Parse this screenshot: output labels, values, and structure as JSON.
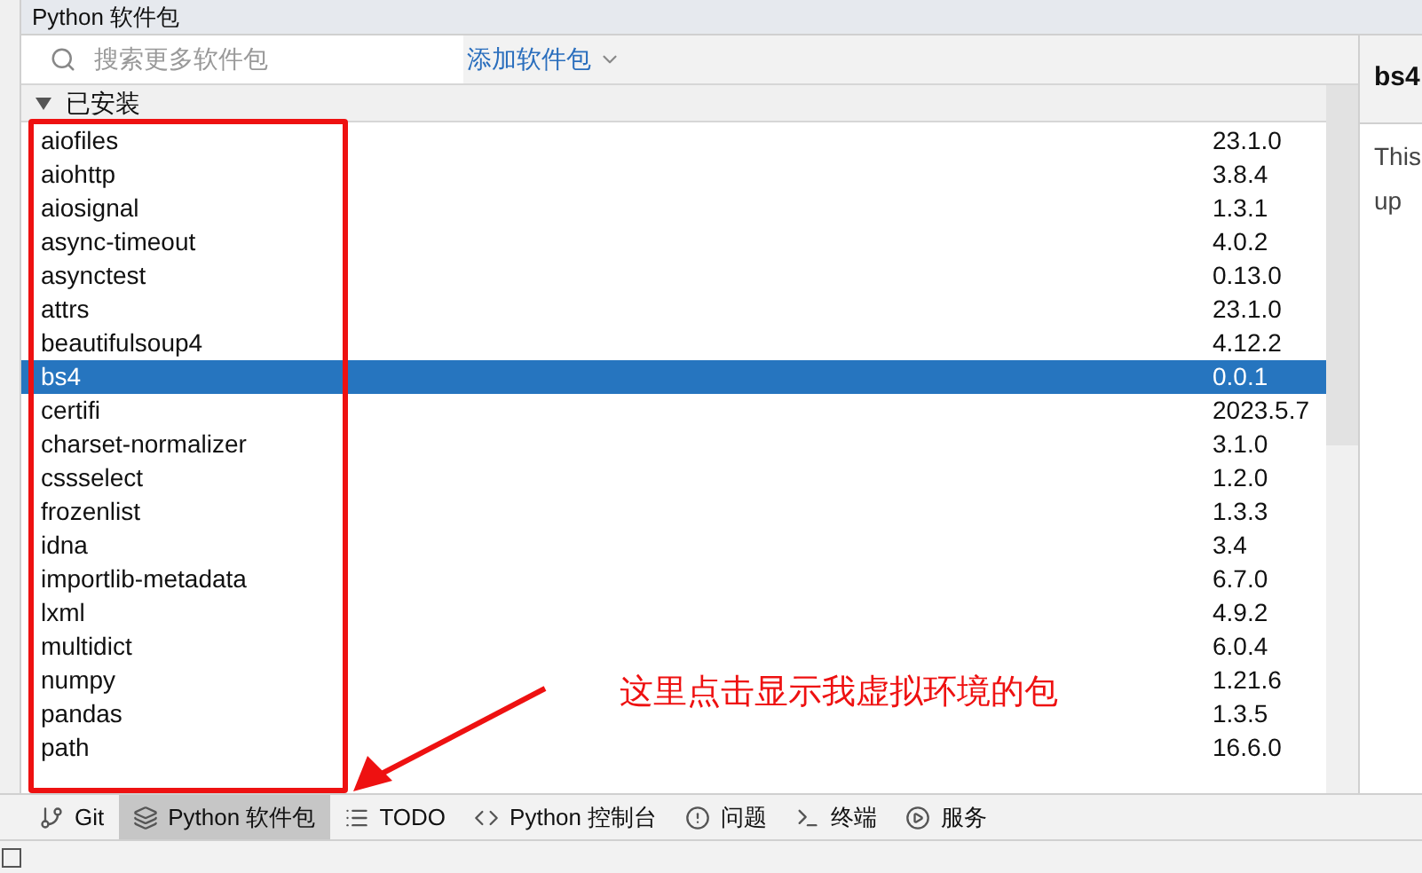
{
  "panel": {
    "title": "Python 软件包"
  },
  "search": {
    "placeholder": "搜索更多软件包"
  },
  "add_button": {
    "label": "添加软件包"
  },
  "group": {
    "label": "已安装",
    "expanded": true
  },
  "packages": [
    {
      "name": "aiofiles",
      "version": "23.1.0",
      "selected": false
    },
    {
      "name": "aiohttp",
      "version": "3.8.4",
      "selected": false
    },
    {
      "name": "aiosignal",
      "version": "1.3.1",
      "selected": false
    },
    {
      "name": "async-timeout",
      "version": "4.0.2",
      "selected": false
    },
    {
      "name": "asynctest",
      "version": "0.13.0",
      "selected": false
    },
    {
      "name": "attrs",
      "version": "23.1.0",
      "selected": false
    },
    {
      "name": "beautifulsoup4",
      "version": "4.12.2",
      "selected": false
    },
    {
      "name": "bs4",
      "version": "0.0.1",
      "selected": true
    },
    {
      "name": "certifi",
      "version": "2023.5.7",
      "selected": false
    },
    {
      "name": "charset-normalizer",
      "version": "3.1.0",
      "selected": false
    },
    {
      "name": "cssselect",
      "version": "1.2.0",
      "selected": false
    },
    {
      "name": "frozenlist",
      "version": "1.3.3",
      "selected": false
    },
    {
      "name": "idna",
      "version": "3.4",
      "selected": false
    },
    {
      "name": "importlib-metadata",
      "version": "6.7.0",
      "selected": false
    },
    {
      "name": "lxml",
      "version": "4.9.2",
      "selected": false
    },
    {
      "name": "multidict",
      "version": "6.0.4",
      "selected": false
    },
    {
      "name": "numpy",
      "version": "1.21.6",
      "selected": false
    },
    {
      "name": "pandas",
      "version": "1.3.5",
      "selected": false
    },
    {
      "name": "path",
      "version": "16.6.0",
      "selected": false
    }
  ],
  "detail": {
    "title": "bs4",
    "lines": [
      "This",
      "up"
    ]
  },
  "tool_windows": [
    {
      "kind": "git",
      "label": "Git",
      "selected": false
    },
    {
      "kind": "packages",
      "label": "Python 软件包",
      "selected": true
    },
    {
      "kind": "todo",
      "label": "TODO",
      "selected": false
    },
    {
      "kind": "console",
      "label": "Python 控制台",
      "selected": false
    },
    {
      "kind": "problems",
      "label": "问题",
      "selected": false
    },
    {
      "kind": "terminal",
      "label": "终端",
      "selected": false
    },
    {
      "kind": "services",
      "label": "服务",
      "selected": false
    }
  ],
  "annotation": {
    "text": "这里点击显示我虚拟环境的包"
  }
}
